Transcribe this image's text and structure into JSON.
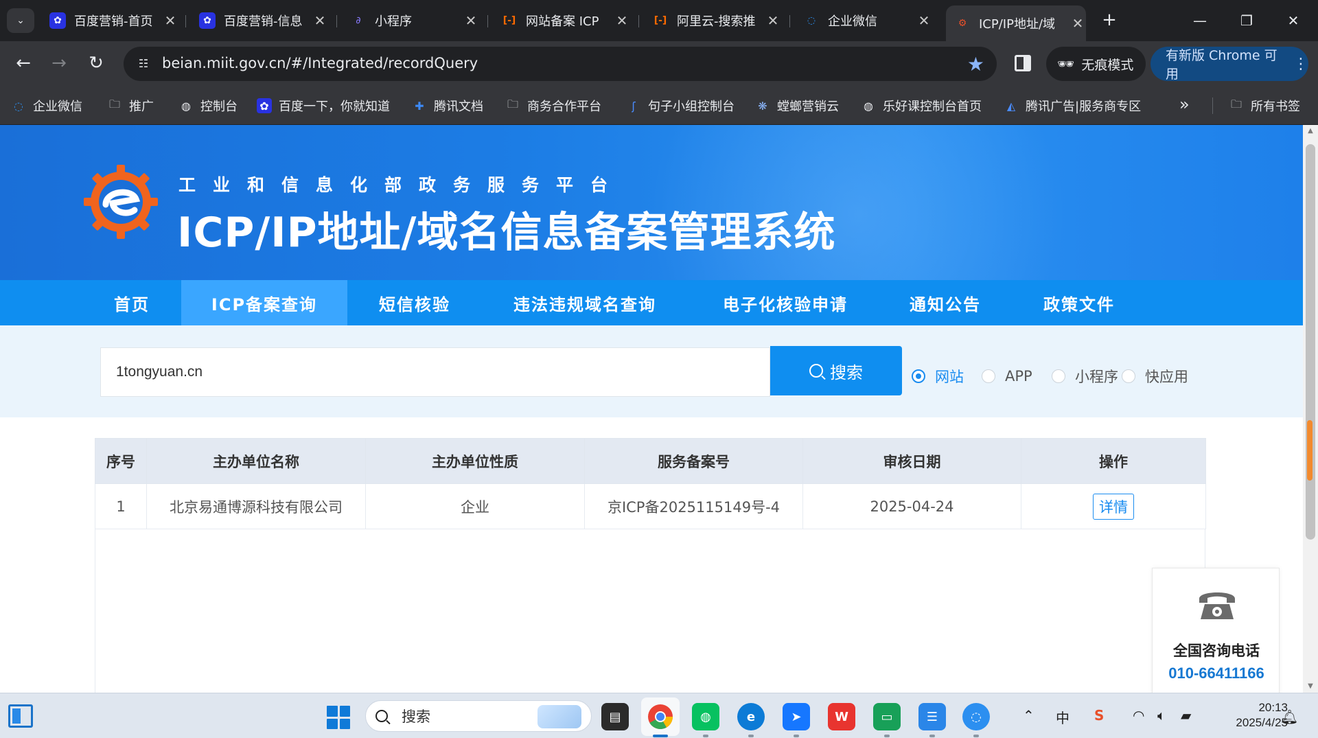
{
  "browser": {
    "tabs": [
      {
        "label": "百度营销-首页",
        "icon": "baidu-paw-icon",
        "color": "#2932e1"
      },
      {
        "label": "百度营销-信息",
        "icon": "baidu-paw-icon",
        "color": "#2932e1"
      },
      {
        "label": "小程序",
        "icon": "link-icon",
        "color": "#7b68ee"
      },
      {
        "label": "网站备案 ICP",
        "icon": "aliyun-icon",
        "color": "#ff6a00"
      },
      {
        "label": "阿里云-搜索推",
        "icon": "aliyun-icon",
        "color": "#ff6a00"
      },
      {
        "label": "企业微信",
        "icon": "wecom-icon",
        "color": "#2c8ff0"
      },
      {
        "label": "ICP/IP地址/域",
        "icon": "miit-gear-icon",
        "color": "#e8502a",
        "active": true
      }
    ],
    "new_tab": "+",
    "window_controls": [
      "—",
      "❐",
      "✕"
    ],
    "address": {
      "host": "beian.miit.gov.cn",
      "path": "/#/Integrated/recordQuery"
    },
    "incognito_label": "无痕模式",
    "update_label": "有新版 Chrome 可用",
    "bookmarks": [
      {
        "label": "企业微信",
        "icon": "wecom-icon"
      },
      {
        "label": "推广",
        "icon": "folder-icon"
      },
      {
        "label": "控制台",
        "icon": "globe-icon"
      },
      {
        "label": "百度一下，你就知道",
        "icon": "baidu-paw-icon"
      },
      {
        "label": "腾讯文档",
        "icon": "tencent-docs-icon"
      },
      {
        "label": "商务合作平台",
        "icon": "folder-icon"
      },
      {
        "label": "句子小组控制台",
        "icon": "juzi-icon"
      },
      {
        "label": "螳螂营销云",
        "icon": "mantis-icon"
      },
      {
        "label": "乐好课控制台首页",
        "icon": "globe-icon"
      },
      {
        "label": "腾讯广告|服务商专区",
        "icon": "tencent-ads-icon"
      }
    ],
    "bookmarks_more": "»",
    "all_bookmarks": "所有书签"
  },
  "site": {
    "subtitle": "工业和信息化部政务服务平台",
    "title": "ICP/IP地址/域名信息备案管理系统",
    "nav": [
      {
        "label": "首页"
      },
      {
        "label": "ICP备案查询",
        "active": true
      },
      {
        "label": "短信核验"
      },
      {
        "label": "违法违规域名查询"
      },
      {
        "label": "电子化核验申请"
      },
      {
        "label": "通知公告"
      },
      {
        "label": "政策文件"
      }
    ],
    "search": {
      "value": "1tongyuan.cn",
      "button": "搜索",
      "types": [
        {
          "label": "网站",
          "checked": true
        },
        {
          "label": "APP"
        },
        {
          "label": "小程序"
        },
        {
          "label": "快应用"
        }
      ]
    },
    "table": {
      "headers": [
        "序号",
        "主办单位名称",
        "主办单位性质",
        "服务备案号",
        "审核日期",
        "操作"
      ],
      "rows": [
        [
          "1",
          "北京易通博源科技有限公司",
          "企业",
          "京ICP备2025115149号-4",
          "2025-04-24",
          "详情"
        ]
      ]
    },
    "consult": {
      "title": "全国咨询电话",
      "phone": "010-66411166"
    }
  },
  "taskbar": {
    "search_placeholder": "搜索",
    "apps": [
      {
        "name": "file-explorer-icon",
        "color": "#2b2b2b"
      },
      {
        "name": "chrome-icon",
        "color": "#4285f4",
        "active": true
      },
      {
        "name": "wechat-icon",
        "color": "#07c160"
      },
      {
        "name": "edge-icon",
        "color": "#0c7bd6"
      },
      {
        "name": "feishu-icon",
        "color": "#1677ff"
      },
      {
        "name": "wps-icon",
        "color": "#e8342f"
      },
      {
        "name": "remote-desktop-icon",
        "color": "#18a058"
      },
      {
        "name": "notepad-icon",
        "color": "#2a86e8"
      },
      {
        "name": "wecom-icon",
        "color": "#2c8ff0"
      }
    ],
    "tray": {
      "ime": "中",
      "time": "20:13",
      "date": "2025/4/25"
    }
  }
}
